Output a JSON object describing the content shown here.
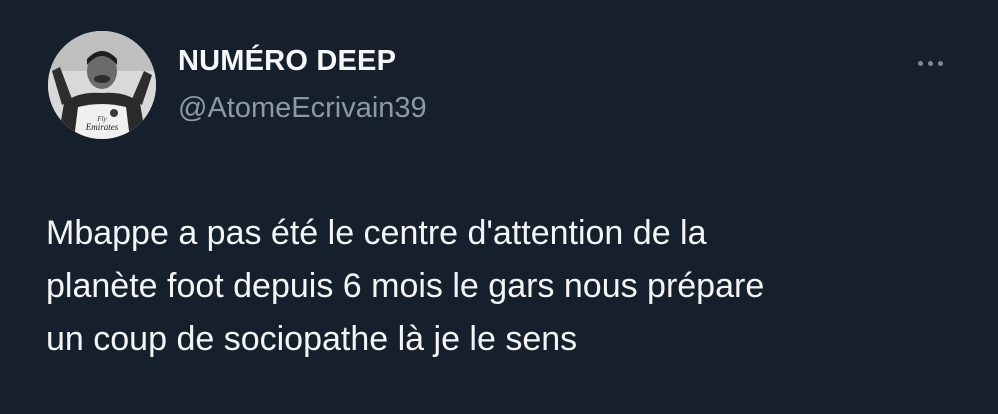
{
  "author": {
    "display_name": "NUMÉRO DEEP",
    "handle": "@AtomeEcrivain39",
    "avatar_text": "Emirates"
  },
  "menu": {
    "icon": "more-horizontal-icon"
  },
  "tweet": {
    "lines": [
      "Mbappe a pas été le centre d'attention de la",
      "planète foot depuis 6 mois le gars nous prépare",
      "un coup de sociopathe là je le sens"
    ]
  },
  "colors": {
    "background": "#16202c",
    "name": "#f5f7f9",
    "handle": "#8b98a5",
    "text": "#f2f4f6"
  }
}
